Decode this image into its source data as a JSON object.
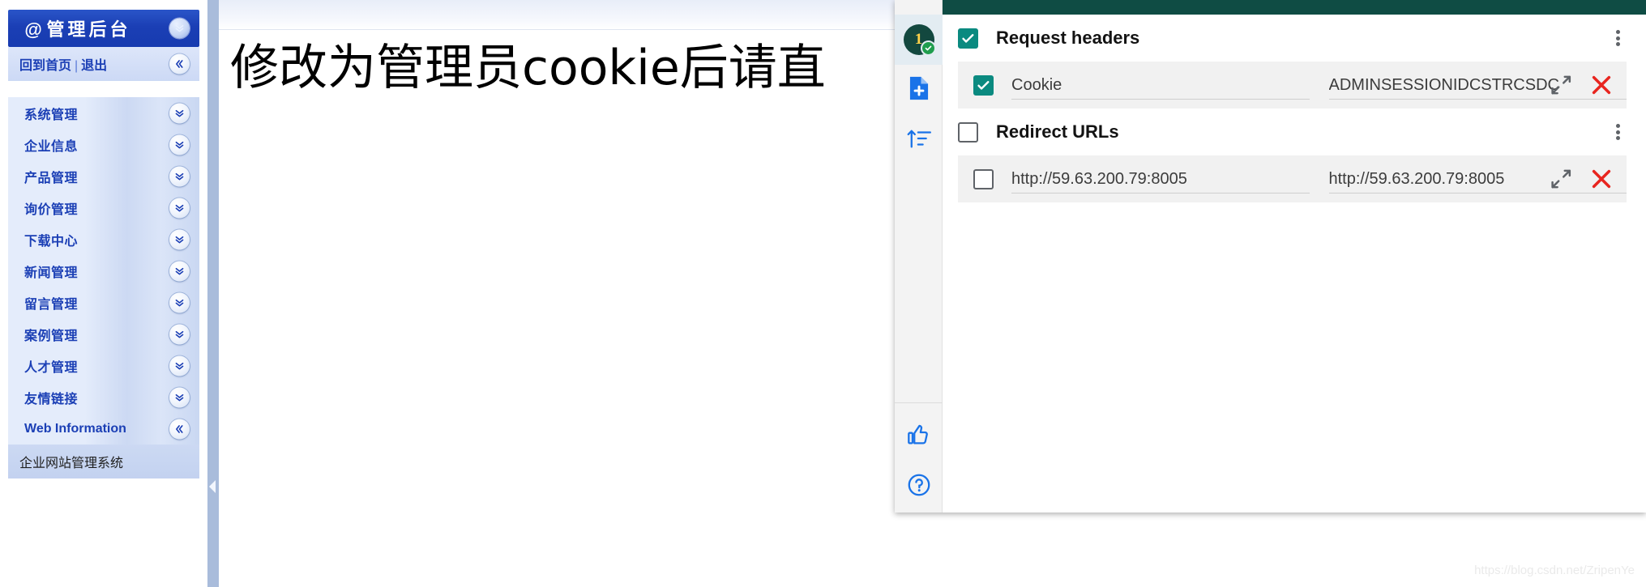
{
  "sidebar": {
    "header": {
      "at_symbol": "@",
      "title": "管理后台",
      "collapse_icon": "chevron-double-down-icon"
    },
    "subbar": {
      "home_link": "回到首页",
      "separator": "|",
      "logout_link": "退出",
      "collapse_icon": "chevron-double-left-icon"
    },
    "menu_items": [
      {
        "label": "系统管理",
        "icon": "chevron-double-down-icon"
      },
      {
        "label": "企业信息",
        "icon": "chevron-double-down-icon"
      },
      {
        "label": "产品管理",
        "icon": "chevron-double-down-icon"
      },
      {
        "label": "询价管理",
        "icon": "chevron-double-down-icon"
      },
      {
        "label": "下载中心",
        "icon": "chevron-double-down-icon"
      },
      {
        "label": "新闻管理",
        "icon": "chevron-double-down-icon"
      },
      {
        "label": "留言管理",
        "icon": "chevron-double-down-icon"
      },
      {
        "label": "案例管理",
        "icon": "chevron-double-down-icon"
      },
      {
        "label": "人才管理",
        "icon": "chevron-double-down-icon"
      },
      {
        "label": "友情链接",
        "icon": "chevron-double-down-icon"
      },
      {
        "label": "Web Information",
        "icon": "chevron-double-left-icon"
      }
    ],
    "footer_label": "企业网站管理系统",
    "accent_color": "#1b3fb5",
    "header_bg": "#1b3fb5"
  },
  "splitter": {
    "collapse_icon": "triangle-left-icon"
  },
  "main": {
    "heading": "修改为管理员cookie后请直"
  },
  "extension": {
    "titlebar_color": "#0f4c44",
    "rail": {
      "profile": {
        "count": "1",
        "status_icon": "check-circle-icon",
        "name": "profile-badge"
      },
      "buttons": [
        {
          "icon": "add-file-icon"
        },
        {
          "icon": "sort-ascending-icon"
        }
      ],
      "bottom_buttons": [
        {
          "icon": "thumbs-up-icon"
        },
        {
          "icon": "help-circle-icon"
        }
      ]
    },
    "sections": [
      {
        "title": "Request headers",
        "checked": true,
        "menu_icon": "kebab-menu-icon",
        "rows": [
          {
            "checked": true,
            "name": "Cookie",
            "value": "ADMINSESSIONIDCSTRCSDC",
            "expand_icon": "expand-diagonal-icon",
            "delete_icon": "close-x-icon"
          }
        ]
      },
      {
        "title": "Redirect URLs",
        "checked": false,
        "menu_icon": "kebab-menu-icon",
        "rows": [
          {
            "checked": false,
            "name": "http://59.63.200.79:8005",
            "value": "http://59.63.200.79:8005",
            "expand_icon": "expand-diagonal-icon",
            "delete_icon": "close-x-icon"
          }
        ]
      }
    ]
  },
  "watermark": "https://blog.csdn.net/ZripenYe"
}
